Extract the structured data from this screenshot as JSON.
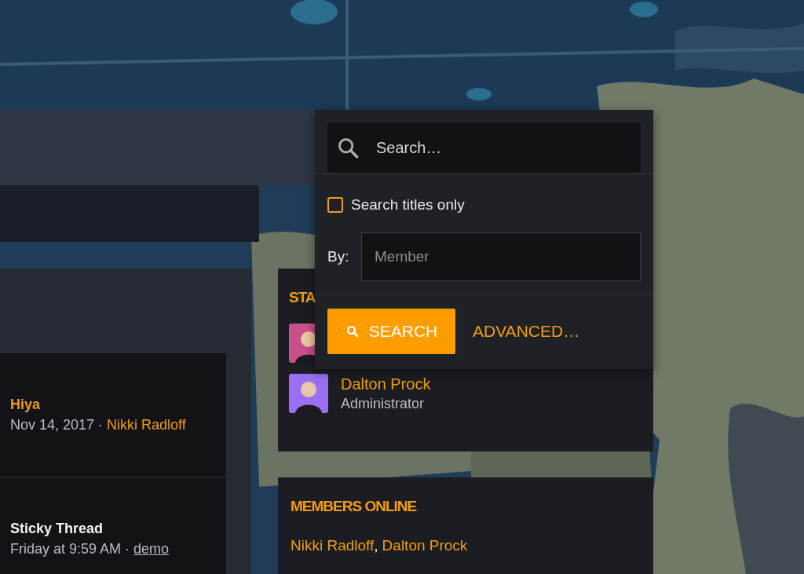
{
  "search_menu": {
    "placeholder": "Search…",
    "titles_only": {
      "label": "Search titles only",
      "checked": false
    },
    "by_label": "By:",
    "member_placeholder": "Member",
    "search_button": "SEARCH",
    "advanced_link": "ADVANCED…"
  },
  "threads": [
    {
      "title": "Hiya",
      "kind": "accent",
      "date": "Nov 14, 2017",
      "separator": "·",
      "author": {
        "name": "Nikki Radloff",
        "kind": "member"
      }
    },
    {
      "title": "Sticky Thread",
      "kind": "plain",
      "date": "Friday at 9:59 AM",
      "separator": "·",
      "author": {
        "name": "demo",
        "kind": "guest"
      }
    }
  ],
  "staff": {
    "title": "STA",
    "members": [
      {
        "color": "#c8508a"
      },
      {
        "name": "Dalton Prock",
        "role": "Administrator",
        "color": "#9b6ff2"
      }
    ]
  },
  "members_online": {
    "title": "MEMBERS ONLINE",
    "names": [
      "Nikki Radloff",
      "Dalton Prock"
    ],
    "separator": ","
  }
}
